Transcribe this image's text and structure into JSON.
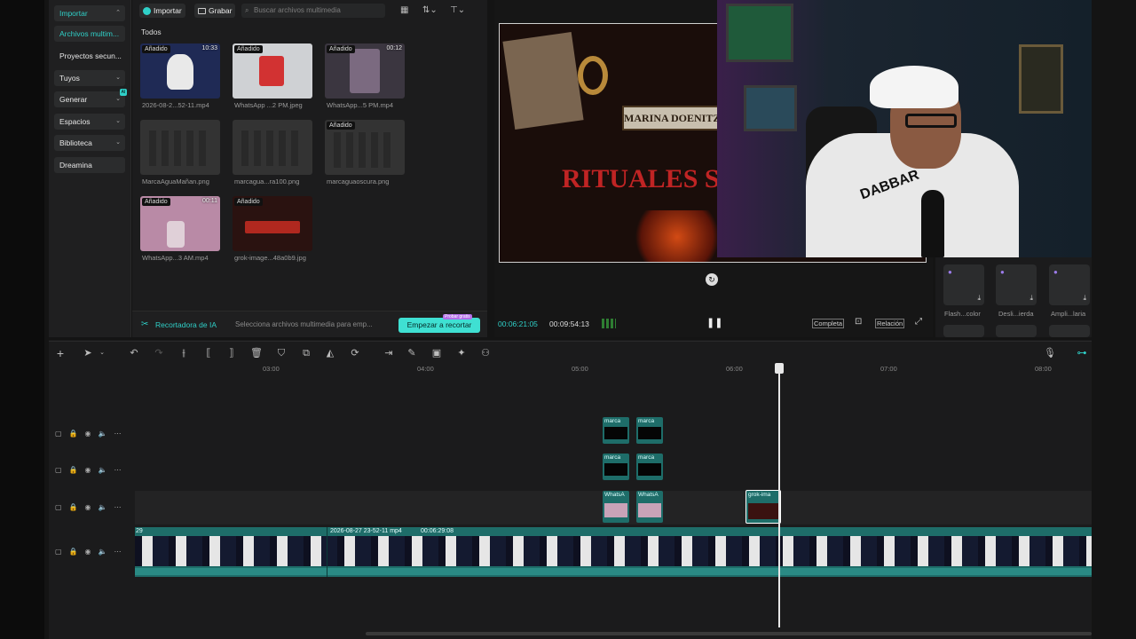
{
  "sidebar": {
    "import": "Importar",
    "items": [
      {
        "label": "Archivos multim..."
      },
      {
        "label": "Proyectos secun..."
      },
      {
        "label": "Tuyos"
      },
      {
        "label": "Generar"
      },
      {
        "label": "Espacios"
      },
      {
        "label": "Biblioteca"
      },
      {
        "label": "Dreamina"
      }
    ]
  },
  "media": {
    "import_btn": "Importar",
    "record_btn": "Grabar",
    "search_placeholder": "Buscar archivos multimedia",
    "section": "Todos",
    "added_label": "Añadido",
    "items": [
      {
        "name": "2026-08-2...52-11.mp4",
        "duration": "10:33",
        "added": true
      },
      {
        "name": "WhatsApp ...2 PM.jpeg",
        "duration": "",
        "added": true
      },
      {
        "name": "WhatsApp...5 PM.mp4",
        "duration": "00:12",
        "added": true
      },
      {
        "name": "MarcaAguaMañan.png",
        "duration": "",
        "added": false
      },
      {
        "name": "marcagua...ra100.png",
        "duration": "",
        "added": false
      },
      {
        "name": "marcaguaoscura.png",
        "duration": "",
        "added": true
      },
      {
        "name": "WhatsApp...3 AM.mp4",
        "duration": "00:11",
        "added": true
      },
      {
        "name": "grok-image...48a0b9.jpg",
        "duration": "",
        "added": true
      }
    ],
    "ai_label": "Recortadora de IA",
    "ai_text": "Selecciona archivos multimedia para emp...",
    "ai_button": "Empezar a recortar",
    "ai_badge": "Probar gratis"
  },
  "preview": {
    "overlay_title": "MARINA DOENITZ",
    "overlay_caption": "RITUALES SATÁ",
    "time_current": "00:06:21:05",
    "time_total": "00:09:54:13",
    "full_btn": "Completa",
    "ratio_btn": "Relación"
  },
  "webcam": {
    "shirt_text": "DABBAR"
  },
  "effects": {
    "items": [
      {
        "name": "Flash...color"
      },
      {
        "name": "Desli...ierda"
      },
      {
        "name": "Ampli...laria"
      }
    ]
  },
  "timeline": {
    "ticks": [
      "03:00",
      "04:00",
      "05:00",
      "06:00",
      "07:00",
      "08:00"
    ],
    "clip_marca": "marca",
    "clip_whats": "WhatsA",
    "clip_grok": "grok-ima",
    "main_clip_start": "29",
    "main_clip_name": "2026-08-27 23-52-11 mp4",
    "main_clip_duration": "00:06:29:08"
  },
  "colors": {
    "accent": "#2fd0c8",
    "track": "#1e6d69",
    "button": "#3fe0d2"
  }
}
